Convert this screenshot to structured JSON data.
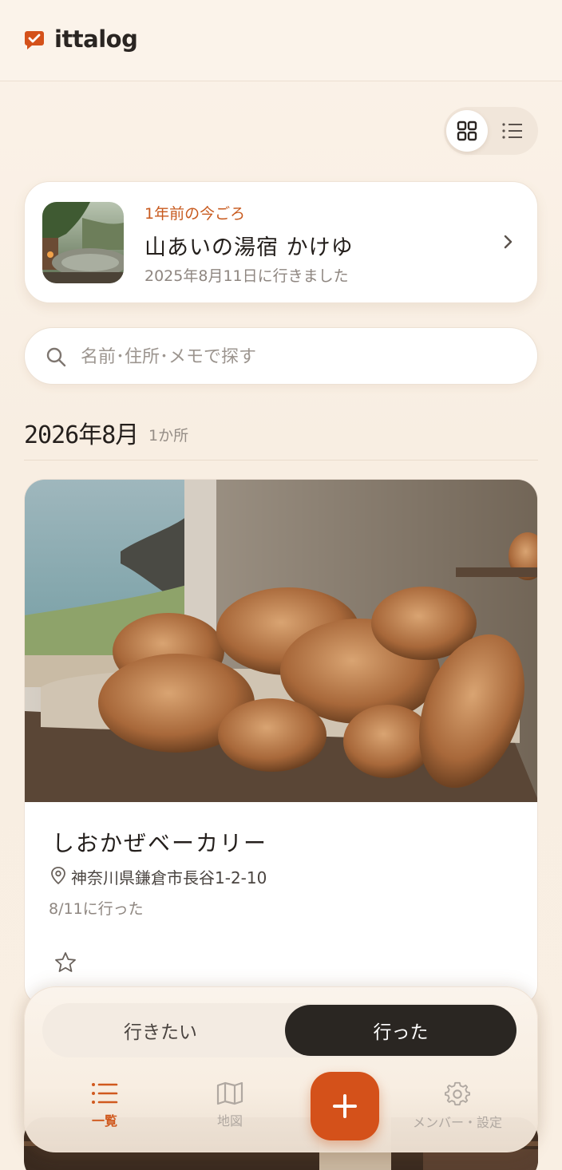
{
  "app": {
    "name": "ittalog",
    "accent": "#d4511a"
  },
  "view_toggle": {
    "grid_icon": "grid-icon",
    "list_icon": "list-icon",
    "active": "grid"
  },
  "memory": {
    "kicker": "1年前の今ごろ",
    "title": "山あいの湯宿 かけゆ",
    "date": "2025年8月11日に行きました"
  },
  "search": {
    "placeholder": "名前･住所･メモで探す",
    "value": ""
  },
  "section": {
    "month": "2026年8月",
    "count": "1か所"
  },
  "places": [
    {
      "name": "しおかぜベーカリー",
      "address": "神奈川県鎌倉市長谷1-2-10",
      "visited": "8/11に行った",
      "favorite": false
    }
  ],
  "segment": {
    "want": "行きたい",
    "went": "行った",
    "active": "went"
  },
  "nav": {
    "list": "一覧",
    "map": "地図",
    "add": "+",
    "settings": "メンバー・設定"
  }
}
